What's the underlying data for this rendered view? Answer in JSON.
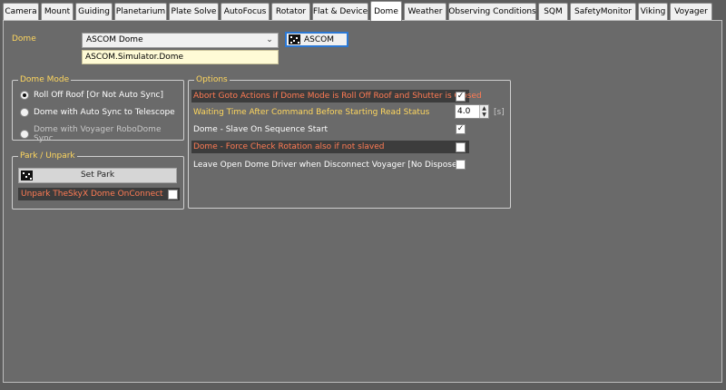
{
  "tabs": [
    {
      "label": "Camera",
      "active": false
    },
    {
      "label": "Mount",
      "active": false
    },
    {
      "label": "Guiding",
      "active": false
    },
    {
      "label": "Planetarium",
      "active": false
    },
    {
      "label": "Plate Solve",
      "active": false
    },
    {
      "label": "AutoFocus",
      "active": false
    },
    {
      "label": "Rotator",
      "active": false
    },
    {
      "label": "Flat & Device",
      "active": false
    },
    {
      "label": "Dome",
      "active": true
    },
    {
      "label": "Weather",
      "active": false
    },
    {
      "label": "Observing Conditions",
      "active": false
    },
    {
      "label": "SQM",
      "active": false
    },
    {
      "label": "SafetyMonitor",
      "active": false
    },
    {
      "label": "Viking",
      "active": false
    },
    {
      "label": "Voyager",
      "active": false
    }
  ],
  "dome": {
    "label": "Dome",
    "driver_selected": "ASCOM Dome",
    "driver_id": "ASCOM.Simulator.Dome",
    "ascom_button": "ASCOM"
  },
  "dome_mode": {
    "title": "Dome Mode",
    "options": [
      {
        "label": "Roll Off Roof [Or Not Auto Sync]",
        "selected": true,
        "enabled": true
      },
      {
        "label": "Dome  with Auto Sync to Telescope",
        "selected": false,
        "enabled": true
      },
      {
        "label": "Dome  with Voyager RoboDome Sync",
        "selected": false,
        "enabled": false
      }
    ]
  },
  "park": {
    "title": "Park / Unpark",
    "set_park_button": "Set Park",
    "unpark_label": "Unpark TheSkyX Dome OnConnect",
    "unpark_checked": false
  },
  "options": {
    "title": "Options",
    "abort_goto": {
      "label": "Abort Goto Actions if Dome Mode is Roll Off Roof and Shutter is Closed",
      "checked": true
    },
    "waiting_time": {
      "label": "Waiting Time After Command Before Starting Read Status",
      "value": "4.0",
      "unit": "[s]"
    },
    "slave_on_start": {
      "label": "Dome - Slave On Sequence Start",
      "checked": true
    },
    "force_check_rotation": {
      "label": "Dome - Force Check Rotation also if not slaved",
      "checked": false
    },
    "leave_open": {
      "label": "Leave Open Dome Driver when Disconnect Voyager [No Dispose]",
      "checked": false
    }
  },
  "colors": {
    "background": "#5d5d5d",
    "panel": "#6a6a6a",
    "label_yellow": "#ffd75e",
    "label_red": "#ff7b54",
    "focus_blue": "#2b78d4"
  }
}
